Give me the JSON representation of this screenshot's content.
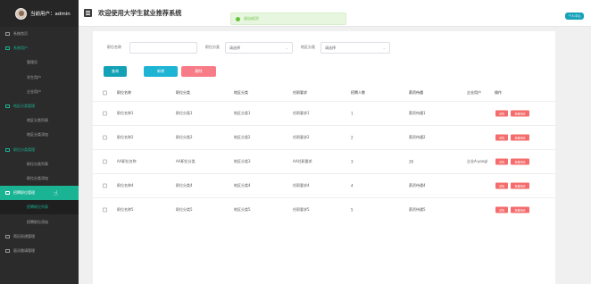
{
  "sidebar": {
    "user_label": "当前用户：admin",
    "items": [
      {
        "label": "系统首页",
        "type": "top"
      },
      {
        "label": "系统用户",
        "type": "top",
        "state": "active-group"
      },
      {
        "label": "管理员",
        "type": "sub"
      },
      {
        "label": "学生用户",
        "type": "sub"
      },
      {
        "label": "企业用户",
        "type": "sub"
      },
      {
        "label": "地区分类管理",
        "type": "top",
        "state": "active-group"
      },
      {
        "label": "地区分类列表",
        "type": "sub"
      },
      {
        "label": "地区分类添加",
        "type": "sub"
      },
      {
        "label": "职位分类管理",
        "type": "top",
        "state": "active-group"
      },
      {
        "label": "职位分类列表",
        "type": "sub"
      },
      {
        "label": "职位分类添加",
        "type": "sub"
      },
      {
        "label": "招聘职位管理",
        "type": "top",
        "state": "active-bg"
      },
      {
        "label": "招聘职位列表",
        "type": "sub",
        "state": "active"
      },
      {
        "label": "招聘职位添加",
        "type": "sub"
      },
      {
        "label": "简历投递管理",
        "type": "top"
      },
      {
        "label": "面试邀请管理",
        "type": "top"
      }
    ]
  },
  "header": {
    "title": "欢迎使用大学生就业推荐系统",
    "toast": "退出成功!",
    "user_pill": "个人中心"
  },
  "search": {
    "job_name_label": "职位名称",
    "job_name_value": "",
    "job_category_label": "职位分类",
    "job_category_value": "请选择",
    "region_category_label": "地区分类",
    "region_category_value": "请选择"
  },
  "buttons": {
    "search": "查询",
    "add": "新增",
    "delete": "删除"
  },
  "table": {
    "headers": [
      "职位名称",
      "职位分类",
      "地区分类",
      "任职要求",
      "招聘人数",
      "薪资待遇",
      "企业用户",
      "操作"
    ],
    "rows": [
      [
        "职位名称1",
        "职位分类1",
        "地区分类1",
        "任职要求1",
        "1",
        "薪资待遇1",
        ""
      ],
      [
        "职位名称2",
        "职位分类2",
        "地区分类2",
        "任职要求2",
        "2",
        "薪资待遇2",
        ""
      ],
      [
        "AA职位名称",
        "AA职位分类",
        "地区分类3",
        "AA任职要求",
        "3",
        "26",
        "企业A-yongl"
      ],
      [
        "职位名称4",
        "职位分类4",
        "地区分类4",
        "任职要求4",
        "4",
        "薪资待遇4",
        ""
      ],
      [
        "职位名称5",
        "职位分类5",
        "地区分类5",
        "任职要求5",
        "5",
        "薪资待遇5",
        ""
      ]
    ],
    "op_edit": "详情",
    "op_view": "查看简历"
  },
  "colors": {
    "accent": "#1ab394",
    "sidebar_bg": "#2b2b2b",
    "delete": "#f87c87",
    "op": "#f56c6c"
  }
}
